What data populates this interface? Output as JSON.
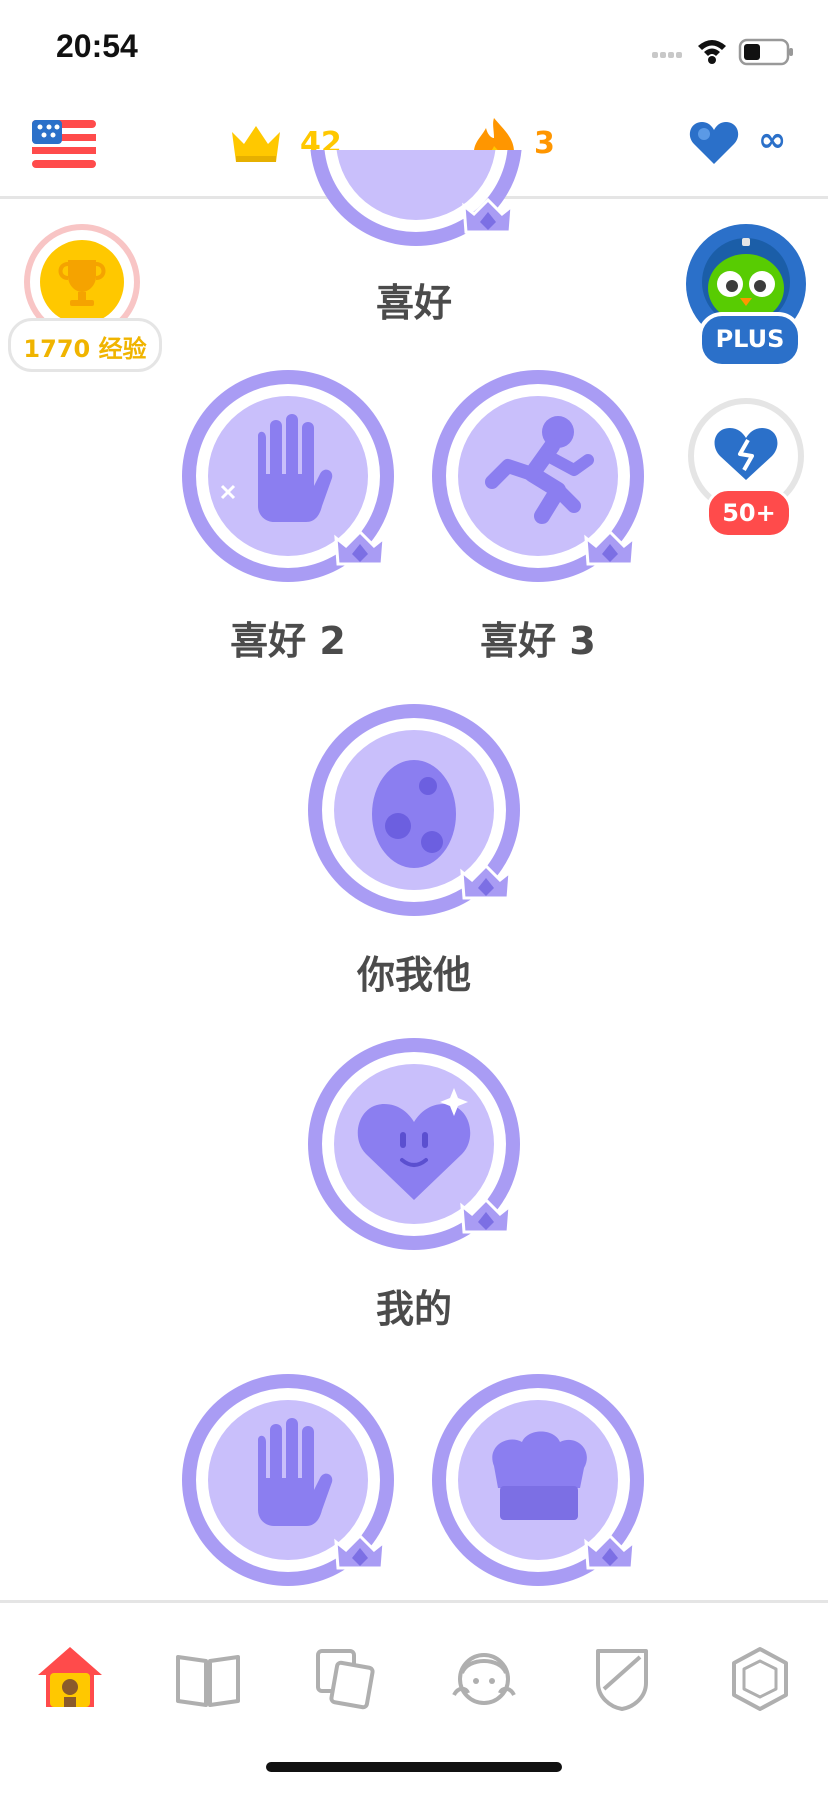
{
  "status_bar": {
    "time": "20:54"
  },
  "top_bar": {
    "flag_icon": "us-flag-icon",
    "crowns": "42",
    "streak": "3",
    "hearts": "∞"
  },
  "side": {
    "xp_label": "1770 经验",
    "plus_label": "PLUS",
    "hearts_badge": "50+"
  },
  "lessons": [
    {
      "label": "喜好",
      "icon": "partial-node"
    },
    {
      "label": "喜好 2",
      "icon": "hand-icon"
    },
    {
      "label": "喜好 3",
      "icon": "runner-icon"
    },
    {
      "label": "你我他",
      "icon": "egg-icon"
    },
    {
      "label": "我的",
      "icon": "heart-face-icon"
    },
    {
      "label": "",
      "icon": "hand-icon"
    },
    {
      "label": "",
      "icon": "chef-hat-icon"
    }
  ],
  "nav": [
    "home-icon",
    "book-icon",
    "cards-icon",
    "profile-icon",
    "shield-icon",
    "store-icon"
  ],
  "colors": {
    "node_purple": "#a99cf4",
    "node_inner": "#c9bffb",
    "crown_yellow": "#ffc800",
    "streak_orange": "#ff9600",
    "heart_blue": "#1cb0f6",
    "accent_blue": "#2b70c9"
  }
}
